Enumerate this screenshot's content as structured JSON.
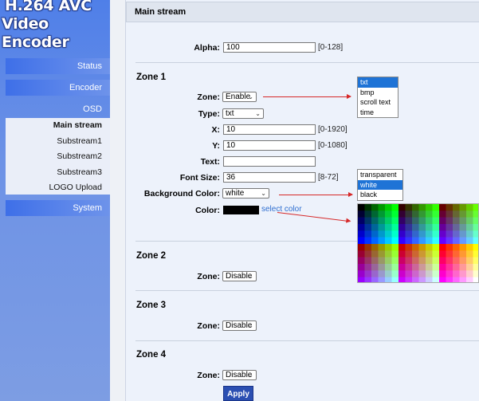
{
  "logo": {
    "line1": "H.264 AVC",
    "line2": "Video Encoder"
  },
  "nav": {
    "status": "Status",
    "encoder": "Encoder",
    "osd": "OSD",
    "system": "System",
    "submenu": [
      "Main stream",
      "Substream1",
      "Substream2",
      "Substream3",
      "LOGO Upload"
    ]
  },
  "main": {
    "title": "Main stream",
    "alpha": {
      "label": "Alpha:",
      "value": "100",
      "range": "[0-128]"
    },
    "zone1": {
      "title": "Zone 1",
      "zone": {
        "label": "Zone:",
        "value": "Enable"
      },
      "type": {
        "label": "Type:",
        "value": "txt"
      },
      "x": {
        "label": "X:",
        "value": "10",
        "range": "[0-1920]"
      },
      "y": {
        "label": "Y:",
        "value": "10",
        "range": "[0-1080]"
      },
      "text": {
        "label": "Text:",
        "value": ""
      },
      "font_size": {
        "label": "Font Size:",
        "value": "36",
        "range": "[8-72]"
      },
      "background_color": {
        "label": "Background Color:",
        "value": "white"
      },
      "color": {
        "label": "Color:",
        "swatch": "#000000",
        "link": "select color"
      }
    },
    "zone2": {
      "title": "Zone 2",
      "label": "Zone:",
      "value": "Disable"
    },
    "zone3": {
      "title": "Zone 3",
      "label": "Zone:",
      "value": "Disable"
    },
    "zone4": {
      "title": "Zone 4",
      "label": "Zone:",
      "value": "Disable"
    },
    "apply": "Apply"
  },
  "type_options": [
    "txt",
    "bmp",
    "scroll text",
    "time"
  ],
  "type_selected": 0,
  "bg_options": [
    "transparent",
    "white",
    "black"
  ],
  "bg_selected": 1,
  "colors": {
    "accent": "#1e73d6",
    "arrow": "#d62828",
    "link": "#2f6fd0"
  }
}
